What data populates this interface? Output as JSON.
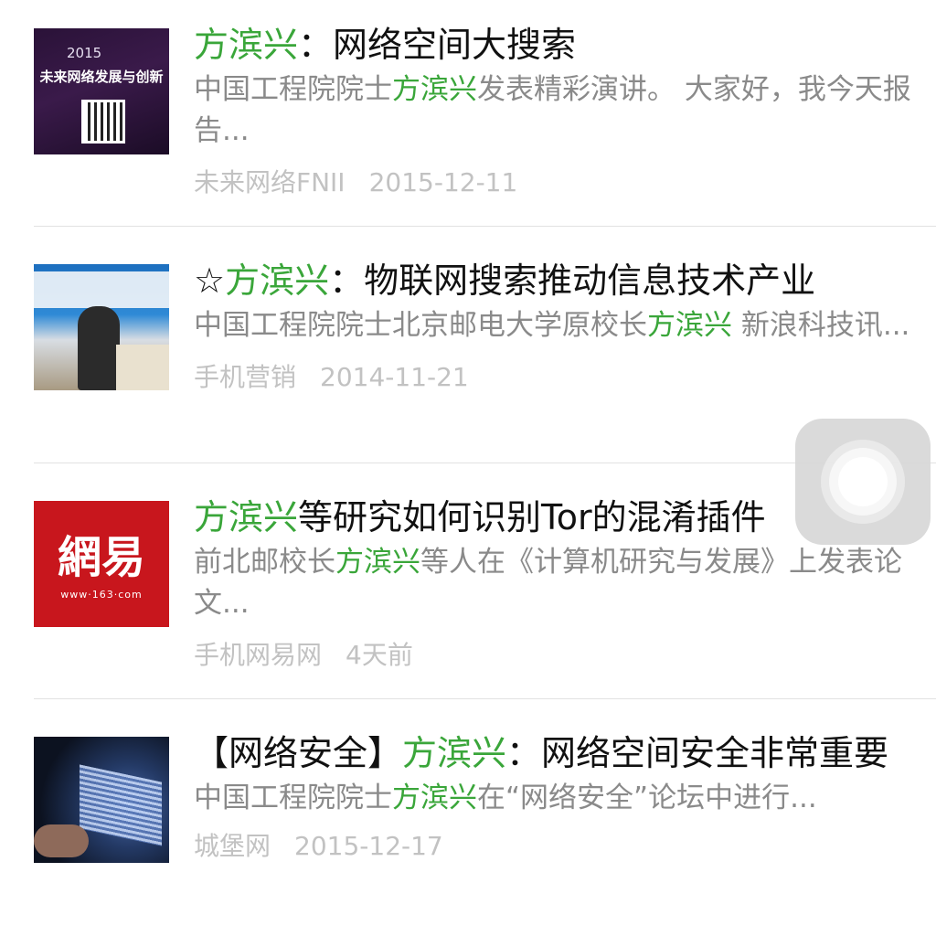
{
  "results": [
    {
      "thumbnail": {
        "icon": "conference-poster-thumbnail",
        "text_year": "2015",
        "text_banner": "未来网络发展与创新"
      },
      "title_prefix": "",
      "title_highlight": "方滨兴",
      "title_rest": "：网络空间大搜索",
      "snippet_before": "中国工程院院士",
      "snippet_highlight": "方滨兴",
      "snippet_after": "发表精彩演讲。 大家好，我今天报告...",
      "source": "未来网络FNII",
      "date": "2015-12-11"
    },
    {
      "thumbnail": {
        "icon": "speaker-photo-thumbnail"
      },
      "title_prefix": "☆",
      "title_highlight": "方滨兴",
      "title_rest": "：物联网搜索推动信息技术产业",
      "snippet_before": "中国工程院院士北京邮电大学原校长",
      "snippet_highlight": "方滨兴",
      "snippet_after": " 新浪科技讯...",
      "source": "手机营销",
      "date": "2014-11-21"
    },
    {
      "thumbnail": {
        "icon": "netease-logo-thumbnail",
        "text_logo": "網易",
        "text_url": "www·163·com"
      },
      "title_prefix": "",
      "title_highlight": "方滨兴",
      "title_rest": "等研究如何识别Tor的混淆插件",
      "snippet_before": "前北邮校长",
      "snippet_highlight": "方滨兴",
      "snippet_after": "等人在《计算机研究与发展》上发表论文...",
      "source": "手机网易网",
      "date": "4天前"
    },
    {
      "thumbnail": {
        "icon": "hacker-screen-thumbnail"
      },
      "title_prefix": "【网络安全】",
      "title_highlight": "方滨兴",
      "title_rest": "：网络空间安全非常重要",
      "snippet_before": "中国工程院院士",
      "snippet_highlight": "方滨兴",
      "snippet_after": "在“网络安全”论坛中进行...",
      "source": "城堡网",
      "date": "2015-12-17"
    }
  ],
  "colors": {
    "highlight": "#3aa63a",
    "title": "#111111",
    "snippet": "#8a8a8a",
    "meta": "#c2c2c2",
    "divider": "#e2e2e2"
  },
  "assistive_touch": {
    "icon": "assistive-touch-icon"
  }
}
